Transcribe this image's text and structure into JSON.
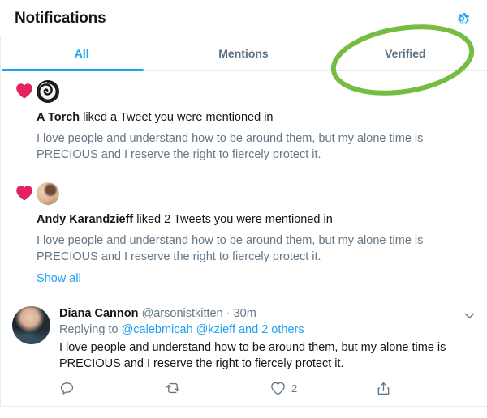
{
  "header": {
    "title": "Notifications",
    "settings_icon": "gear-icon"
  },
  "tabs": [
    {
      "label": "All",
      "active": true
    },
    {
      "label": "Mentions",
      "active": false
    },
    {
      "label": "Verified",
      "active": false
    }
  ],
  "annotation": {
    "shape": "ellipse",
    "color": "#76bc43",
    "target_tab": "Verified"
  },
  "notifications": [
    {
      "type": "like",
      "badge_icon": "heart-filled-icon",
      "badge_color": "#e0245e",
      "avatar": "spiral-avatar",
      "actor": "A Torch",
      "action_text": " liked a Tweet you were mentioned in",
      "quoted_text": "I love people and understand how to be around them, but my alone time is PRECIOUS and I reserve the right to fiercely protect it.",
      "show_all_label": null
    },
    {
      "type": "like",
      "badge_icon": "heart-filled-icon",
      "badge_color": "#e0245e",
      "avatar": "andy-avatar",
      "actor": "Andy Karandzieff",
      "action_text": " liked 2 Tweets you were mentioned in",
      "quoted_text": "I love people and understand how to be around them, but my alone time is PRECIOUS and I reserve the right to fiercely protect it.",
      "show_all_label": "Show all"
    }
  ],
  "tweet": {
    "avatar": "diana-avatar",
    "author": "Diana Cannon",
    "handle": "@arsonistkitten",
    "separator": "·",
    "timestamp": "30m",
    "replying_prefix": "Replying to ",
    "replying_mentions": "@calebmicah @kzieff and 2 others",
    "text": "I love people and understand how to be around them, but my alone time is PRECIOUS and I reserve the right to fiercely protect it.",
    "caret_icon": "chevron-down-icon",
    "actions": [
      {
        "icon": "reply-icon",
        "count": ""
      },
      {
        "icon": "retweet-icon",
        "count": ""
      },
      {
        "icon": "like-icon",
        "count": "2"
      },
      {
        "icon": "share-icon",
        "count": ""
      }
    ]
  },
  "colors": {
    "brand_blue": "#1da1f2",
    "like_pink": "#e0245e",
    "muted_text": "#657786",
    "dark_text": "#14171a",
    "divider": "#e6ecf0",
    "annotation_green": "#76bc43"
  }
}
